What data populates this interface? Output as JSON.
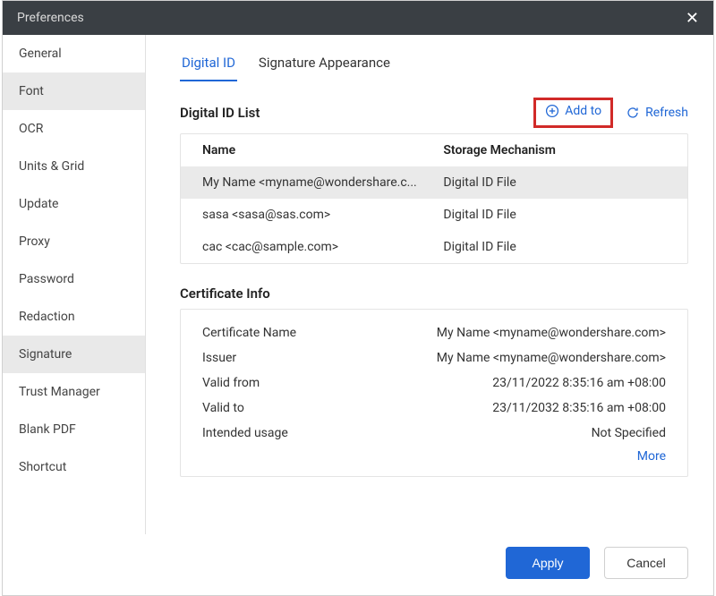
{
  "window": {
    "title": "Preferences"
  },
  "sidebar": {
    "items": [
      {
        "label": "General",
        "active": false
      },
      {
        "label": "Font",
        "active": true
      },
      {
        "label": "OCR",
        "active": false
      },
      {
        "label": "Units & Grid",
        "active": false
      },
      {
        "label": "Update",
        "active": false
      },
      {
        "label": "Proxy",
        "active": false
      },
      {
        "label": "Password",
        "active": false
      },
      {
        "label": "Redaction",
        "active": false
      },
      {
        "label": "Signature",
        "active": true
      },
      {
        "label": "Trust Manager",
        "active": false
      },
      {
        "label": "Blank PDF",
        "active": false
      },
      {
        "label": "Shortcut",
        "active": false
      }
    ]
  },
  "tabs": [
    {
      "label": "Digital ID",
      "active": true
    },
    {
      "label": "Signature Appearance",
      "active": false
    }
  ],
  "idList": {
    "title": "Digital ID List",
    "addLabel": "Add to",
    "refreshLabel": "Refresh",
    "headers": {
      "name": "Name",
      "mech": "Storage Mechanism"
    },
    "rows": [
      {
        "name": "My Name <myname@wondershare.c...",
        "mech": "Digital ID File",
        "selected": true
      },
      {
        "name": "sasa <sasa@sas.com>",
        "mech": "Digital ID File",
        "selected": false
      },
      {
        "name": "cac <cac@sample.com>",
        "mech": "Digital ID File",
        "selected": false
      }
    ]
  },
  "certInfo": {
    "title": "Certificate Info",
    "rows": [
      {
        "label": "Certificate Name",
        "value": "My Name <myname@wondershare.com>"
      },
      {
        "label": "Issuer",
        "value": "My Name <myname@wondershare.com>"
      },
      {
        "label": "Valid from",
        "value": "23/11/2022 8:35:16 am +08:00"
      },
      {
        "label": "Valid to",
        "value": "23/11/2032 8:35:16 am +08:00"
      },
      {
        "label": "Intended usage",
        "value": "Not Specified"
      }
    ],
    "moreLabel": "More"
  },
  "footer": {
    "applyLabel": "Apply",
    "cancelLabel": "Cancel"
  }
}
